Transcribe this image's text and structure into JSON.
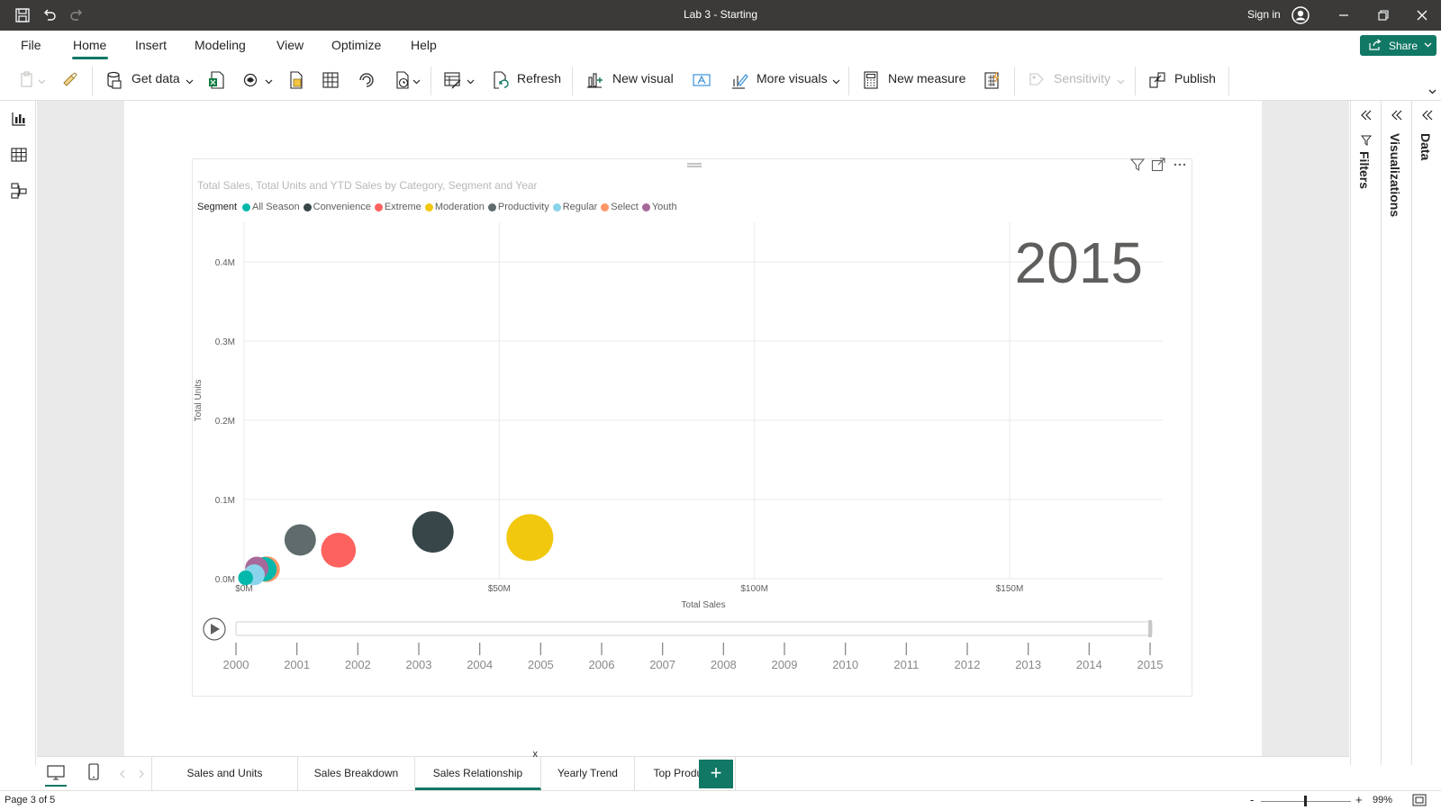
{
  "window": {
    "title": "Lab 3 - Starting",
    "sign_in": "Sign in"
  },
  "menu": {
    "items": [
      "File",
      "Home",
      "Insert",
      "Modeling",
      "View",
      "Optimize",
      "Help"
    ],
    "active": "Home",
    "share": "Share"
  },
  "ribbon": {
    "get_data": "Get data",
    "refresh": "Refresh",
    "new_visual": "New visual",
    "more_visuals": "More visuals",
    "new_measure": "New measure",
    "sensitivity": "Sensitivity",
    "publish": "Publish"
  },
  "panes": {
    "filters": "Filters",
    "visualizations": "Visualizations",
    "data": "Data"
  },
  "visual": {
    "title": "Total Sales, Total Units and YTD Sales by Category, Segment and Year",
    "legend_title": "Segment",
    "play_year": "2015",
    "xlabel": "Total Sales",
    "ylabel": "Total Units"
  },
  "chart_data": {
    "type": "scatter",
    "title": "Total Sales, Total Units and YTD Sales by Category, Segment and Year",
    "xlabel": "Total Sales",
    "ylabel": "Total Units",
    "xlim": [
      0,
      180
    ],
    "ylim": [
      0,
      0.45
    ],
    "x_ticks": [
      "$0M",
      "$50M",
      "$100M",
      "$150M"
    ],
    "x_tick_values": [
      0,
      50,
      100,
      150
    ],
    "y_ticks": [
      "0.0M",
      "0.1M",
      "0.2M",
      "0.3M",
      "0.4M"
    ],
    "y_tick_values": [
      0,
      0.1,
      0.2,
      0.3,
      0.4
    ],
    "legend_title": "Segment",
    "series": [
      {
        "name": "All Season",
        "color": "#01B8AA"
      },
      {
        "name": "Convenience",
        "color": "#374649"
      },
      {
        "name": "Extreme",
        "color": "#FD625E"
      },
      {
        "name": "Moderation",
        "color": "#F2C80F"
      },
      {
        "name": "Productivity",
        "color": "#5F6B6D"
      },
      {
        "name": "Regular",
        "color": "#8AD4EB"
      },
      {
        "name": "Select",
        "color": "#FE9666"
      },
      {
        "name": "Youth",
        "color": "#A66999"
      }
    ],
    "points": [
      {
        "segment": "Moderation",
        "x": 56,
        "y": 0.052,
        "size": 1.0
      },
      {
        "segment": "Convenience",
        "x": 37,
        "y": 0.059,
        "size": 0.78
      },
      {
        "segment": "Extreme",
        "x": 18.5,
        "y": 0.036,
        "size": 0.55
      },
      {
        "segment": "Productivity",
        "x": 11,
        "y": 0.049,
        "size": 0.45
      },
      {
        "segment": "Select",
        "x": 4.5,
        "y": 0.012,
        "size": 0.3
      },
      {
        "segment": "All Season",
        "x": 4,
        "y": 0.012,
        "size": 0.27
      },
      {
        "segment": "Youth",
        "x": 2.5,
        "y": 0.013,
        "size": 0.25
      },
      {
        "segment": "Regular",
        "x": 2,
        "y": 0.005,
        "size": 0.2
      },
      {
        "segment": "All Season",
        "x": 0.3,
        "y": 0.001,
        "size": 0.1
      }
    ],
    "play_axis": {
      "years": [
        "2000",
        "2001",
        "2002",
        "2003",
        "2004",
        "2005",
        "2006",
        "2007",
        "2008",
        "2009",
        "2010",
        "2011",
        "2012",
        "2013",
        "2014",
        "2015"
      ],
      "current": "2015"
    },
    "grid": true,
    "legend_position": "top-left"
  },
  "tabs": {
    "items": [
      "Sales and Units",
      "Sales Breakdown",
      "Sales Relationship",
      "Yearly Trend",
      "Top Products"
    ],
    "active": "Sales Relationship",
    "close": "x",
    "add": "+"
  },
  "status": {
    "page": "Page 3 of 5",
    "zoom": "99%",
    "zoom_minus": "-",
    "zoom_plus": "+"
  }
}
